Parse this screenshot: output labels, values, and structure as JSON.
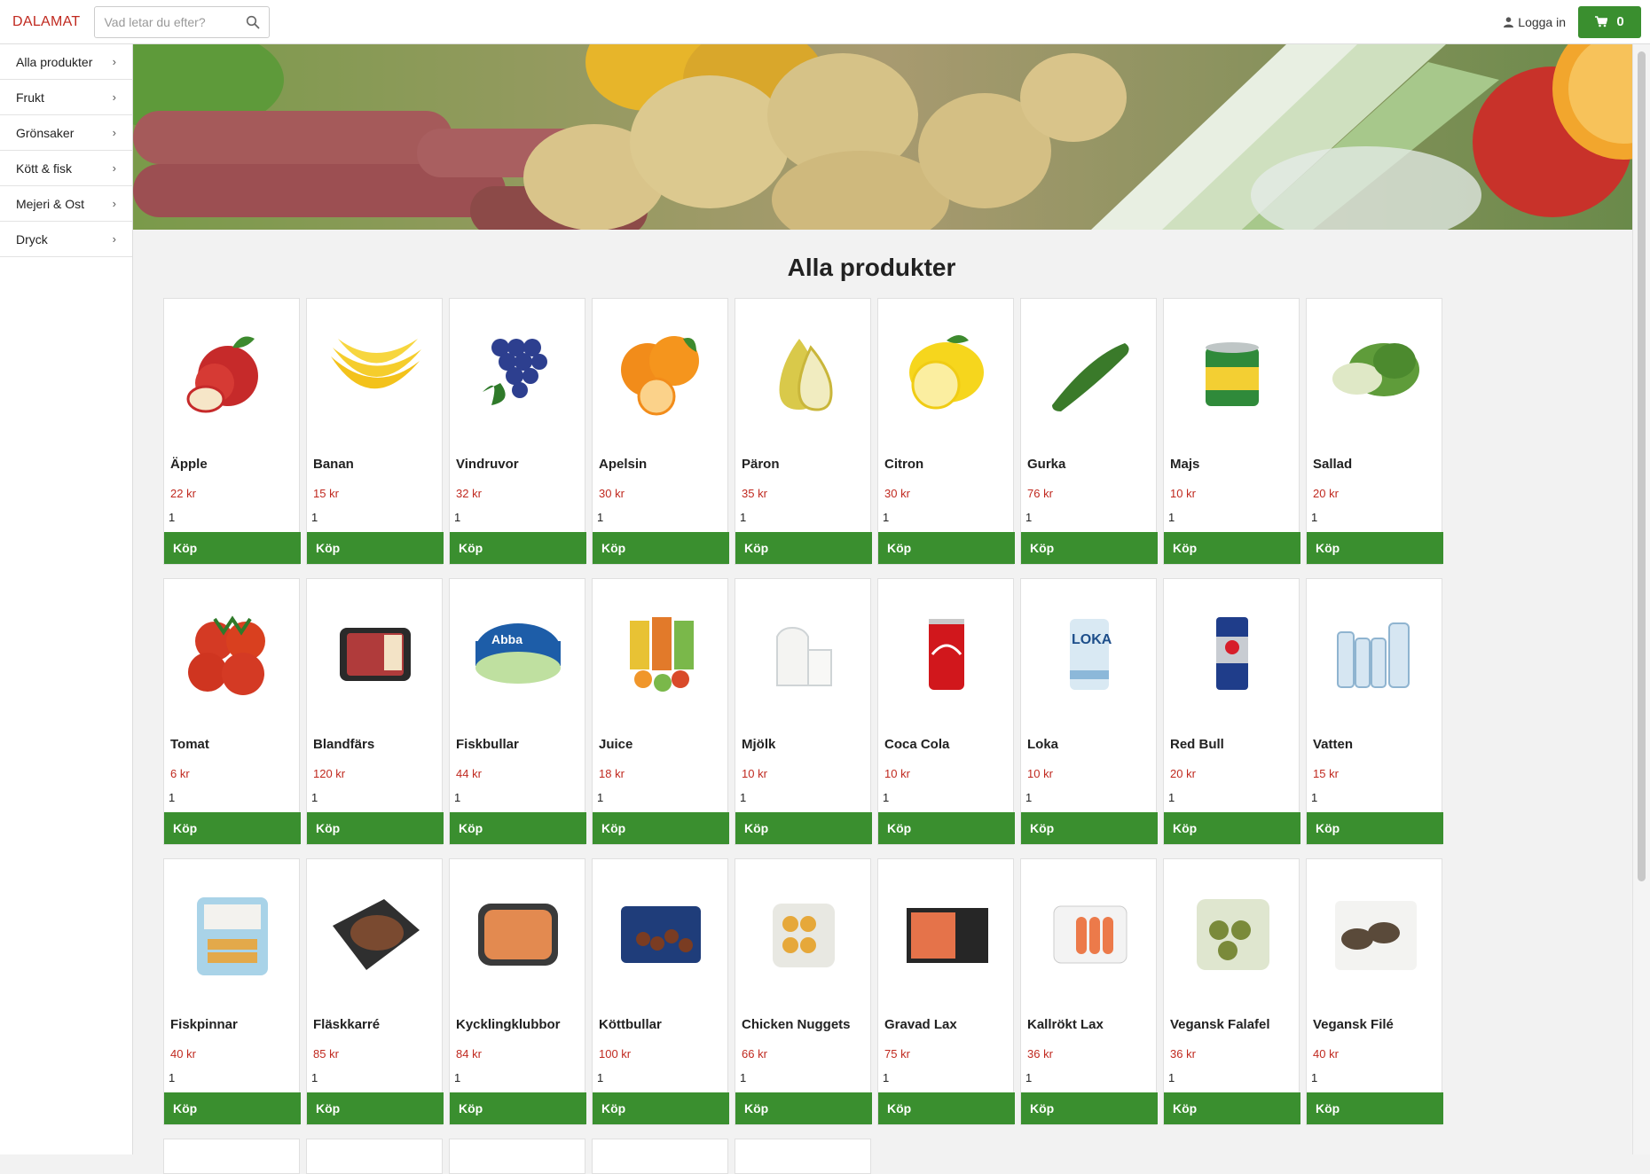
{
  "topbar": {
    "brand": "DALAMAT",
    "search_placeholder": "Vad letar du efter?",
    "login_label": "Logga in",
    "cart_count": "0"
  },
  "sidebar": {
    "items": [
      {
        "label": "Alla produkter"
      },
      {
        "label": "Frukt"
      },
      {
        "label": "Grönsaker"
      },
      {
        "label": "Kött & fisk"
      },
      {
        "label": "Mejeri & Ost"
      },
      {
        "label": "Dryck"
      }
    ]
  },
  "main": {
    "title": "Alla produkter",
    "buy_label": "Köp",
    "products": [
      {
        "name": "Äpple",
        "price": "22 kr",
        "qty": "1",
        "icon": "apple-icon"
      },
      {
        "name": "Banan",
        "price": "15 kr",
        "qty": "1",
        "icon": "banana-icon"
      },
      {
        "name": "Vindruvor",
        "price": "32 kr",
        "qty": "1",
        "icon": "grapes-icon"
      },
      {
        "name": "Apelsin",
        "price": "30 kr",
        "qty": "1",
        "icon": "orange-icon"
      },
      {
        "name": "Päron",
        "price": "35 kr",
        "qty": "1",
        "icon": "pear-icon"
      },
      {
        "name": "Citron",
        "price": "30 kr",
        "qty": "1",
        "icon": "lemon-icon"
      },
      {
        "name": "Gurka",
        "price": "76 kr",
        "qty": "1",
        "icon": "cucumber-icon"
      },
      {
        "name": "Majs",
        "price": "10 kr",
        "qty": "1",
        "icon": "corn-can-icon"
      },
      {
        "name": "Sallad",
        "price": "20 kr",
        "qty": "1",
        "icon": "lettuce-icon"
      },
      {
        "name": "Tomat",
        "price": "6 kr",
        "qty": "1",
        "icon": "tomato-icon"
      },
      {
        "name": "Blandfärs",
        "price": "120 kr",
        "qty": "1",
        "icon": "minced-meat-icon"
      },
      {
        "name": "Fiskbullar",
        "price": "44 kr",
        "qty": "1",
        "icon": "fish-ball-can-icon"
      },
      {
        "name": "Juice",
        "price": "18 kr",
        "qty": "1",
        "icon": "juice-icon"
      },
      {
        "name": "Mjölk",
        "price": "10 kr",
        "qty": "1",
        "icon": "milk-icon"
      },
      {
        "name": "Coca Cola",
        "price": "10 kr",
        "qty": "1",
        "icon": "cola-can-icon"
      },
      {
        "name": "Loka",
        "price": "10 kr",
        "qty": "1",
        "icon": "loka-can-icon"
      },
      {
        "name": "Red Bull",
        "price": "20 kr",
        "qty": "1",
        "icon": "redbull-can-icon"
      },
      {
        "name": "Vatten",
        "price": "15 kr",
        "qty": "1",
        "icon": "water-bottles-icon"
      },
      {
        "name": "Fiskpinnar",
        "price": "40 kr",
        "qty": "1",
        "icon": "fish-sticks-icon"
      },
      {
        "name": "Fläskkarré",
        "price": "85 kr",
        "qty": "1",
        "icon": "pork-icon"
      },
      {
        "name": "Kycklingklubbor",
        "price": "84 kr",
        "qty": "1",
        "icon": "chicken-drumsticks-icon"
      },
      {
        "name": "Köttbullar",
        "price": "100 kr",
        "qty": "1",
        "icon": "meatballs-icon"
      },
      {
        "name": "Chicken Nuggets",
        "price": "66 kr",
        "qty": "1",
        "icon": "nuggets-icon"
      },
      {
        "name": "Gravad Lax",
        "price": "75 kr",
        "qty": "1",
        "icon": "gravad-lax-icon"
      },
      {
        "name": "Kallrökt Lax",
        "price": "36 kr",
        "qty": "1",
        "icon": "smoked-salmon-icon"
      },
      {
        "name": "Vegansk Falafel",
        "price": "36 kr",
        "qty": "1",
        "icon": "falafel-icon"
      },
      {
        "name": "Vegansk Filé",
        "price": "40 kr",
        "qty": "1",
        "icon": "vegan-fillet-icon"
      }
    ]
  },
  "colors": {
    "brand": "#c0291f",
    "price": "#c0291f",
    "buy_button": "#3a8f2f",
    "cart_button": "#3a8f2f"
  }
}
